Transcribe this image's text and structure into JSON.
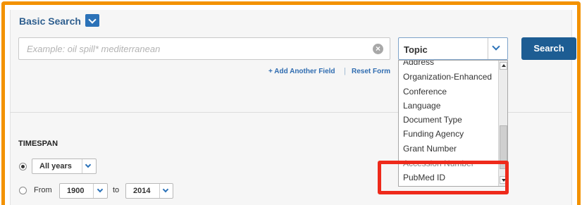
{
  "colors": {
    "frame": "#f39200",
    "accent": "#2b72b8",
    "search_button": "#1d5d93",
    "link": "#2f6cb0",
    "highlight": "#ee2a1b"
  },
  "header": {
    "title": "Basic Search",
    "chevron_icon": "chevron-down-icon"
  },
  "search": {
    "placeholder": "Example: oil spill* mediterranean",
    "value": "",
    "clear_icon": "close-circle-icon",
    "clear_glyph": "×"
  },
  "field_select": {
    "selected": "Topic",
    "options": [
      "Address",
      "Organization-Enhanced",
      "Conference",
      "Language",
      "Document Type",
      "Funding Agency",
      "Grant Number",
      "Accession Number",
      "PubMed ID"
    ],
    "highlighted_option": "PubMed ID"
  },
  "search_button": {
    "label": "Search"
  },
  "links": {
    "add_field": "+ Add Another Field",
    "separator": "|",
    "reset": "Reset Form"
  },
  "timespan": {
    "title": "TIMESPAN",
    "mode": "All years",
    "range_from_label": "From",
    "from_year": "1900",
    "to_label": "to",
    "to_year": "2014"
  }
}
